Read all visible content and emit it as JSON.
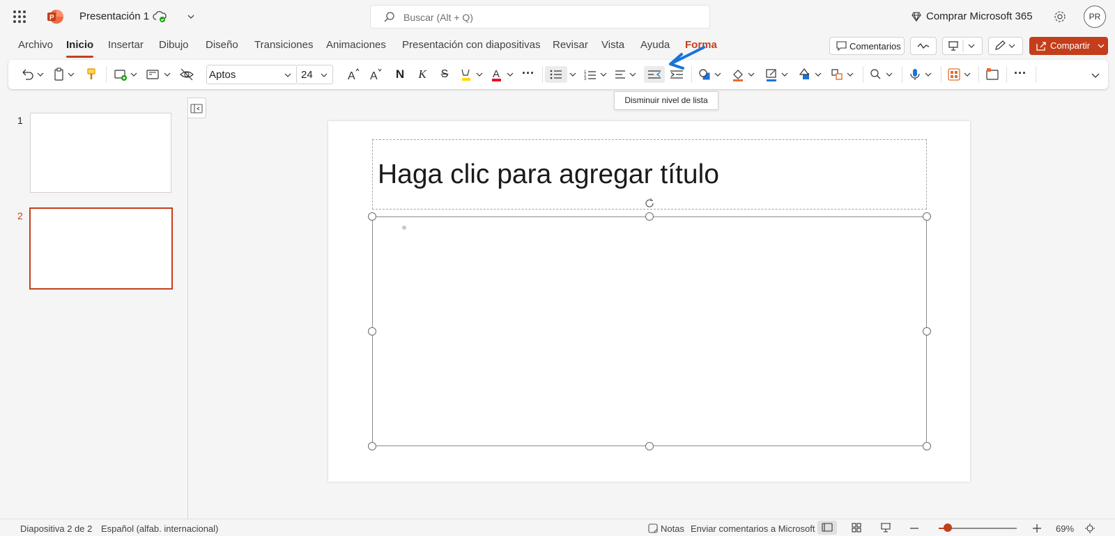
{
  "titlebar": {
    "doc_title": "Presentación 1",
    "search_placeholder": "Buscar (Alt + Q)",
    "buy_label": "Comprar Microsoft 365",
    "avatar_initials": "PR"
  },
  "ribbon_tabs": [
    "Archivo",
    "Inicio",
    "Insertar",
    "Dibujo",
    "Diseño",
    "Transiciones",
    "Animaciones",
    "Presentación con diapositivas",
    "Revisar",
    "Vista",
    "Ayuda",
    "Forma"
  ],
  "active_tab": "Inicio",
  "right_actions": {
    "comments_label": "Comentarios",
    "share_label": "Compartir"
  },
  "toolbar": {
    "font_name": "Aptos",
    "font_size": "24",
    "bold_glyph": "N",
    "italic_glyph": "K",
    "strike_glyph": "S",
    "more_glyph": "···"
  },
  "tooltip": "Disminuir nivel de lista",
  "thumbnails": [
    {
      "number": "1",
      "selected": false
    },
    {
      "number": "2",
      "selected": true
    }
  ],
  "slide": {
    "title_placeholder": "Haga clic para agregar título"
  },
  "statusbar": {
    "slide_position": "Diapositiva 2 de 2",
    "language": "Español (alfab. internacional)",
    "notes_label": "Notas",
    "feedback_label": "Enviar comentarios a Microsoft",
    "zoom_level": "69%"
  },
  "colors": {
    "accent": "#c43e1c",
    "annotation_arrow": "#1a73d9"
  }
}
